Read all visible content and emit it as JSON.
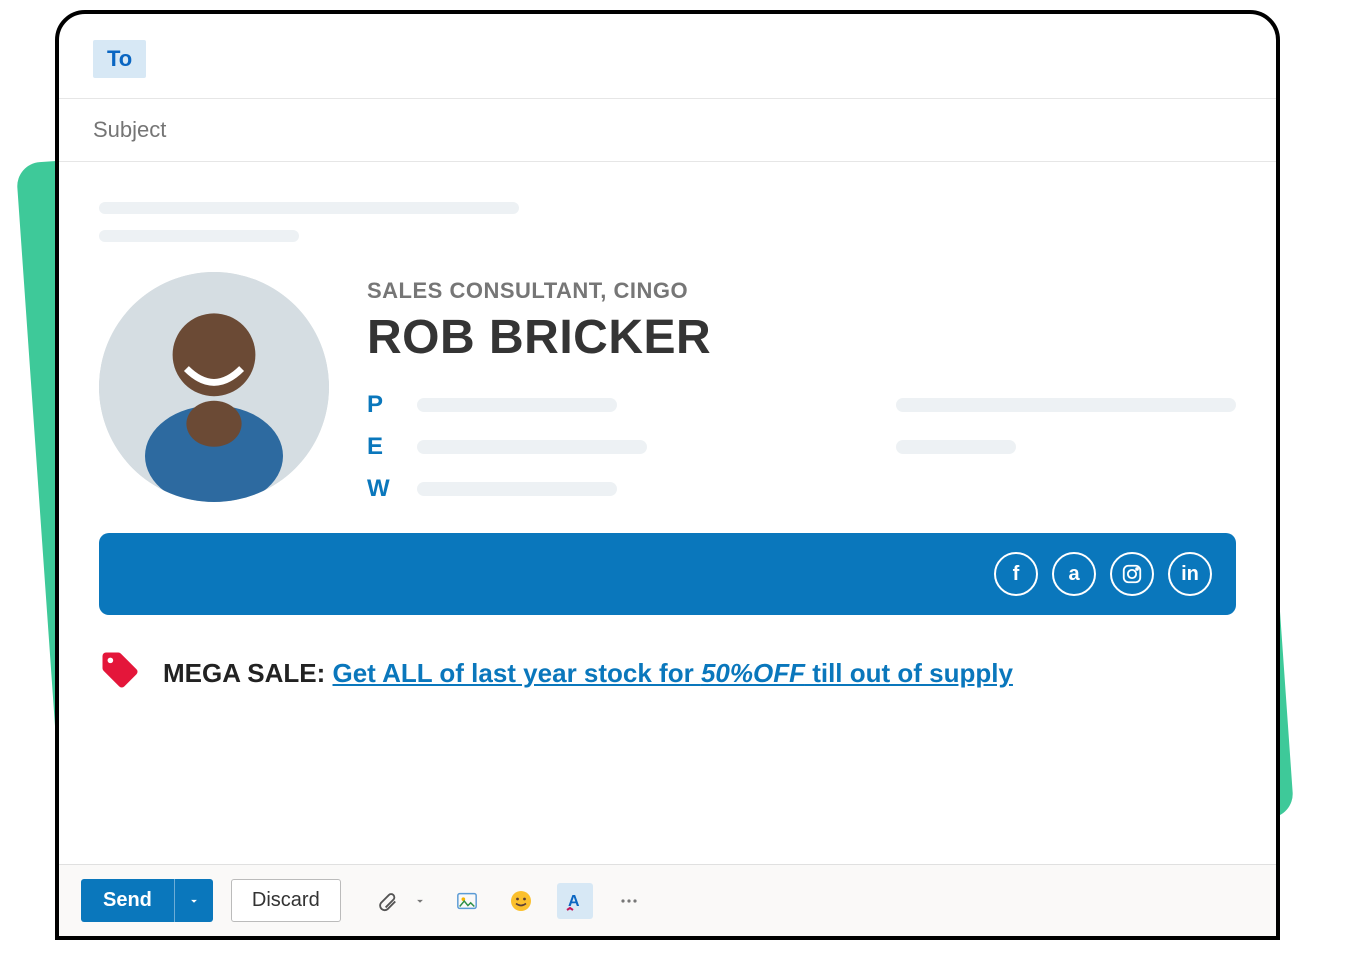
{
  "compose": {
    "to_label": "To",
    "subject_placeholder": "Subject"
  },
  "signature": {
    "title": "SALES CONSULTANT, CINGO",
    "name": "ROB BRICKER",
    "contact_keys": {
      "phone": "P",
      "email": "E",
      "web": "W"
    },
    "social": [
      "facebook",
      "amazon",
      "instagram",
      "linkedin"
    ]
  },
  "promo": {
    "label": "MEGA SALE:",
    "link_prefix": "Get ALL of last year stock for ",
    "link_emph": "50%OFF",
    "link_suffix": " till out of supply"
  },
  "toolbar": {
    "send": "Send",
    "discard": "Discard"
  }
}
